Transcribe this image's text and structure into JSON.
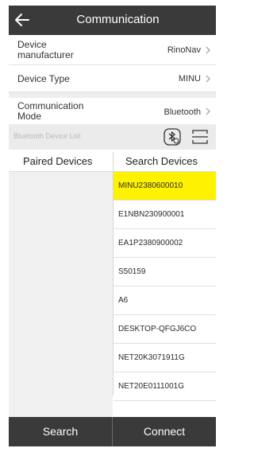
{
  "header": {
    "title": "Communication"
  },
  "settings": {
    "manufacturer": {
      "label": "Device manufacturer",
      "value": "RinoNav"
    },
    "device_type": {
      "label": "Device Type",
      "value": "MINU"
    },
    "comm_mode": {
      "label": "Communication Mode",
      "value": "Bluetooth"
    }
  },
  "bluetooth_bar": {
    "label": "Bluetooth Device List"
  },
  "tabs": {
    "paired": "Paired Devices",
    "search": "Search Devices"
  },
  "devices": [
    {
      "name": "MINU2380600010",
      "selected": true
    },
    {
      "name": "E1NBN230900001",
      "selected": false
    },
    {
      "name": "EA1P2380900002",
      "selected": false
    },
    {
      "name": "S50159",
      "selected": false
    },
    {
      "name": "A6",
      "selected": false
    },
    {
      "name": "DESKTOP-QFGJ6CO",
      "selected": false
    },
    {
      "name": "NET20K3071911G",
      "selected": false
    },
    {
      "name": "NET20E0111001G",
      "selected": false
    }
  ],
  "footer": {
    "search": "Search",
    "connect": "Connect"
  },
  "colors": {
    "header_bg": "#3a3a3a",
    "selected_bg": "#fff200"
  },
  "icons": {
    "back": "arrow-left-icon",
    "chevron": "chevron-right-icon",
    "bluetooth": "bluetooth-settings-icon",
    "scan": "scan-icon"
  }
}
